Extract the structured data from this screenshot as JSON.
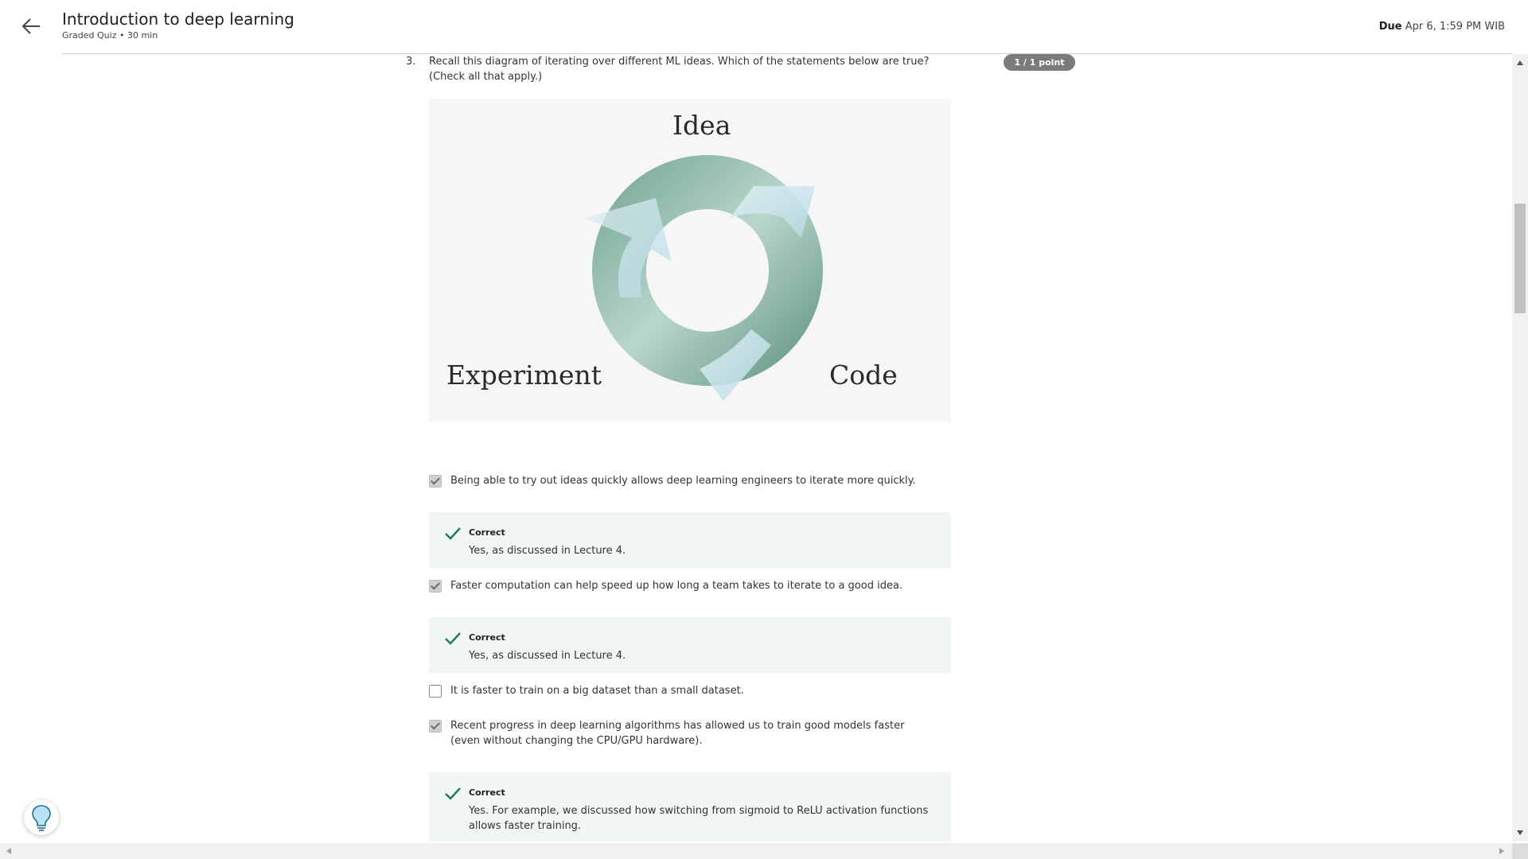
{
  "header": {
    "title": "Introduction to deep learning",
    "subtitle": "Graded Quiz • 30 min",
    "due_label": "Due",
    "due_value": "Apr 6, 1:59 PM WIB"
  },
  "question": {
    "number": "3.",
    "text": "Recall this diagram of iterating over different ML ideas. Which of the statements below are true? (Check all that apply.)",
    "points": "1 / 1 point",
    "diagram": {
      "label_top": "Idea",
      "label_left": "Experiment",
      "label_right": "Code"
    },
    "options": [
      {
        "label": "Being able to try out ideas quickly allows deep learning engineers to iterate more quickly.",
        "checked": true,
        "feedback": {
          "title": "Correct",
          "text": "Yes, as discussed in Lecture 4."
        }
      },
      {
        "label": "Faster computation can help speed up how long a team takes to iterate to a good idea.",
        "checked": true,
        "feedback": {
          "title": "Correct",
          "text": "Yes, as discussed in Lecture 4."
        }
      },
      {
        "label": "It is faster to train on a big dataset than a small dataset.",
        "checked": false
      },
      {
        "label": "Recent progress in deep learning algorithms has allowed us to train good models faster (even without changing the CPU/GPU hardware).",
        "checked": true,
        "feedback": {
          "title": "Correct",
          "text": "Yes. For example, we discussed how switching from sigmoid to ReLU activation functions allows faster training."
        }
      }
    ]
  },
  "icons": {
    "back": "arrow-left-icon",
    "correct": "checkmark-icon",
    "help": "lightbulb-icon"
  },
  "colors": {
    "badge": "#7b7b7b",
    "feedback_bg": "#f1f6f4",
    "correct_check": "#1e7a5a"
  }
}
